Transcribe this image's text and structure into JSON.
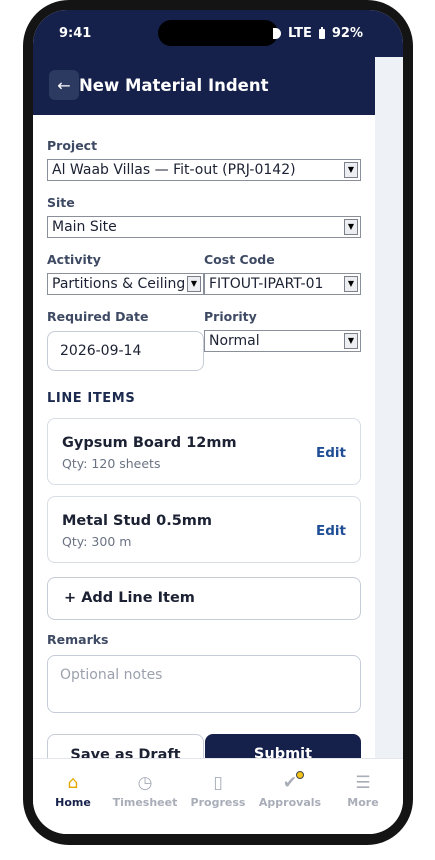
{
  "status_bar": {
    "time": "9:41",
    "network": "LTE",
    "battery": "92%"
  },
  "header": {
    "back_icon": "←",
    "title": "New Material Indent"
  },
  "form": {
    "project": {
      "label": "Project",
      "value": "Al Waab Villas — Fit-out (PRJ-0142)"
    },
    "site": {
      "label": "Site",
      "value": "Main Site"
    },
    "activity": {
      "label": "Activity",
      "value": "Partitions & Ceilings"
    },
    "cost_code": {
      "label": "Cost Code",
      "value": "FITOUT-IPART-01"
    },
    "required_date": {
      "label": "Required Date",
      "value": "2026-09-14"
    },
    "priority": {
      "label": "Priority",
      "value": "Normal"
    },
    "line_items_heading": "LINE ITEMS",
    "line_items": [
      {
        "name": "Gypsum Board 12mm",
        "qty": "Qty: 120 sheets",
        "edit": "Edit"
      },
      {
        "name": "Metal Stud 0.5mm",
        "qty": "Qty: 300 m",
        "edit": "Edit"
      }
    ],
    "add_line_item": "+ Add Line Item",
    "remarks": {
      "label": "Remarks",
      "placeholder": "Optional notes"
    },
    "save_draft": "Save as Draft",
    "submit": "Submit"
  },
  "tabs": [
    {
      "label": "Home",
      "icon": "home-icon",
      "glyph": "⌂"
    },
    {
      "label": "Timesheet",
      "icon": "clock-icon",
      "glyph": "◷"
    },
    {
      "label": "Progress",
      "icon": "clipboard-icon",
      "glyph": "▯"
    },
    {
      "label": "Approvals",
      "icon": "check-icon",
      "glyph": "✔"
    },
    {
      "label": "More",
      "icon": "menu-icon",
      "glyph": "☰"
    }
  ],
  "colors": {
    "primary": "#15214a",
    "accent": "#e0a800",
    "link": "#1f4e96"
  }
}
